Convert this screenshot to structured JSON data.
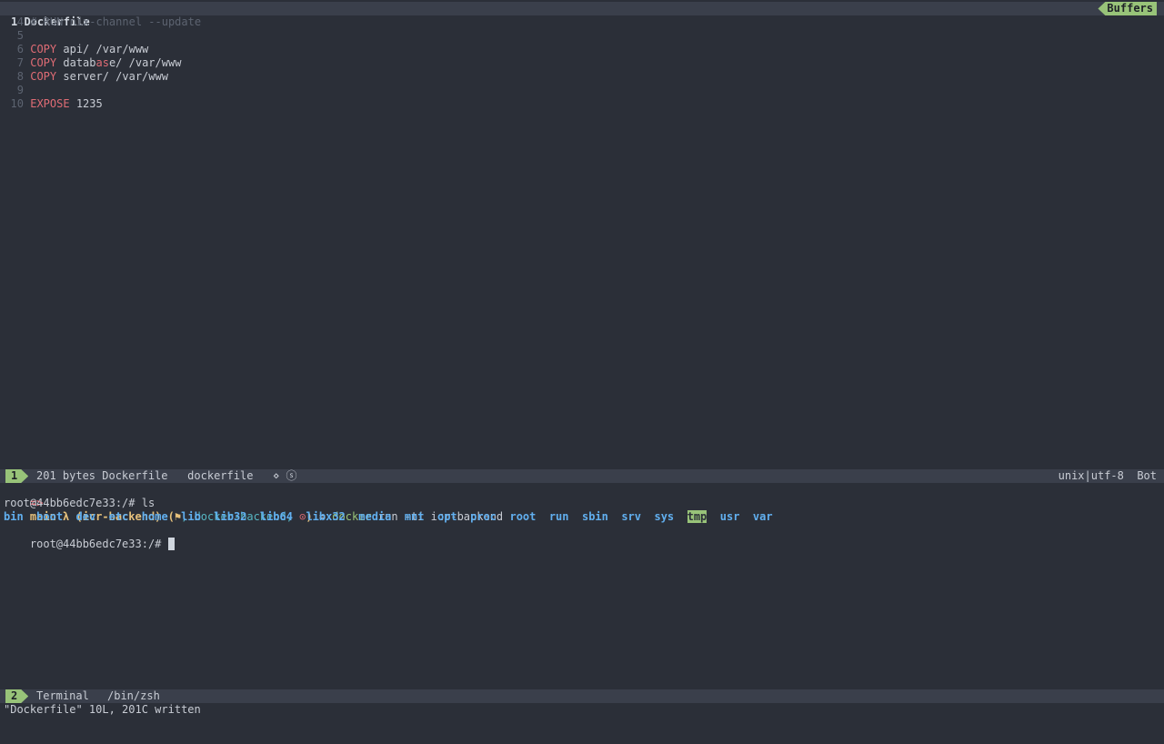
{
  "tabline": {
    "title": "1 Dockerfile",
    "buffers_label": "Buffers"
  },
  "editor": {
    "lines": [
      {
        "num": "4",
        "parts": [
          {
            "cls": "comment",
            "t": "# RUN nix-channel --update"
          }
        ]
      },
      {
        "num": "5",
        "parts": []
      },
      {
        "num": "6",
        "parts": [
          {
            "cls": "kw",
            "t": "COPY"
          },
          {
            "cls": "plain",
            "t": " api/ /var/www"
          }
        ]
      },
      {
        "num": "7",
        "parts": [
          {
            "cls": "kw",
            "t": "COPY"
          },
          {
            "cls": "plain",
            "t": " datab"
          },
          {
            "cls": "hl",
            "t": "as"
          },
          {
            "cls": "plain",
            "t": "e/ /var/www"
          }
        ]
      },
      {
        "num": "8",
        "parts": [
          {
            "cls": "kw",
            "t": "COPY"
          },
          {
            "cls": "plain",
            "t": " server/ /var/www"
          }
        ]
      },
      {
        "num": "9",
        "parts": []
      },
      {
        "num": "10",
        "parts": [
          {
            "cls": "kw",
            "t": "EXPOSE"
          },
          {
            "cls": "plain",
            "t": " 1235"
          }
        ]
      }
    ]
  },
  "status1": {
    "window_num": "1",
    "left": "201 bytes Dockerfile   dockerfile   ⋄ ⓢ",
    "right": "unix|utf-8  Bot"
  },
  "terminal": {
    "prompt_line": {
      "arrow": "=>",
      "branch": "main λ (icr-backend)",
      "mid": " (",
      "icon": "⚑",
      "tag": ", docker-backend, ",
      "dot": "⊙",
      "close": ")",
      "eq": " = ",
      "cmd": "docker",
      "args": " run -ti icr-backend"
    },
    "ls_line": "root@44bb6edc7e33:/# ls",
    "dirs": [
      "bin",
      "boot",
      "dev",
      "etc",
      "home",
      "lib",
      "lib32",
      "lib64",
      "libx32",
      "media",
      "mnt",
      "opt",
      "proc",
      "root",
      "run",
      "sbin",
      "srv",
      "sys",
      "tmp",
      "usr",
      "var"
    ],
    "highlighted_dir": "tmp",
    "prompt2": "root@44bb6edc7e33:/# "
  },
  "status2": {
    "window_num": "2",
    "label": "Terminal",
    "path": "/bin/zsh"
  },
  "message": "\"Dockerfile\" 10L, 201C written",
  "colors": {
    "bg": "#2b2f38",
    "accent_green": "#98c379",
    "keyword": "#e06c75",
    "dir": "#61afef"
  }
}
